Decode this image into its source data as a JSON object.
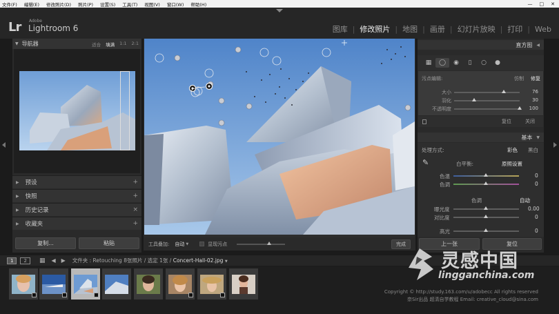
{
  "os_menu": [
    "文件(F)",
    "编辑(E)",
    "修改照片(D)",
    "照片(P)",
    "设置(S)",
    "工具(T)",
    "视图(V)",
    "窗口(W)",
    "帮助(H)"
  ],
  "window_controls": {
    "minimize": "—",
    "maximize": "□",
    "close": "✕"
  },
  "header": {
    "logo": "Lr",
    "adobe": "Adobe",
    "product": "Lightroom 6",
    "modules": [
      "图库",
      "修改照片",
      "地图",
      "画册",
      "幻灯片放映",
      "打印",
      "Web"
    ],
    "active_module": "修改照片"
  },
  "navigator": {
    "title": "导航器",
    "zoom_fit": "适合",
    "zoom_fill": "填满",
    "zoom_1": "1:1",
    "zoom_2": "2:1"
  },
  "left_sections": [
    {
      "label": "预设",
      "action": "+"
    },
    {
      "label": "快照",
      "action": "+"
    },
    {
      "label": "历史记录",
      "action": "×"
    },
    {
      "label": "收藏夹",
      "action": "+"
    }
  ],
  "left_buttons": {
    "copy": "复制...",
    "paste": "粘贴"
  },
  "toolbar": {
    "overlay_label": "工具叠加:",
    "overlay_value": "自动",
    "visualize_label": "显现污点",
    "done": "完成"
  },
  "right": {
    "histogram": "直方图",
    "spot": {
      "label": "污点编辑:",
      "mode_clone": "仿制",
      "mode_heal": "修复",
      "size_label": "大小",
      "size_value": 76,
      "feather_label": "羽化",
      "feather_value": 30,
      "opacity_label": "不透明度",
      "opacity_value": 100,
      "reset": "复位",
      "close": "关闭"
    },
    "basic": {
      "title": "基本",
      "treatment_label": "处理方式:",
      "color": "彩色",
      "bw": "黑白",
      "wb_label": "白平衡:",
      "wb_value": "原照设置",
      "temp_label": "色温",
      "temp_value": 0,
      "tint_label": "色调",
      "tint_value": 0,
      "tone_label": "色调",
      "tone_auto": "自动",
      "exposure_label": "曝光度",
      "exposure_value": "0.00",
      "contrast_label": "对比度",
      "contrast_value": 0,
      "highlights_label": "高光",
      "highlights_value": 0
    },
    "btn_prev": "上一张",
    "btn_reset": "复位"
  },
  "filmstrip": {
    "monitor_1": "1",
    "monitor_2": "2",
    "path_prefix": "文件夹 : Retouching  8张照片 / 选定 1张 /",
    "filename": "Concert-Hall-02.jpg"
  },
  "copyright_line1": "Copyright © http://study.163.com/u/adobecc All rights reserved",
  "copyright_line2": "奈Sir出品  超清自学教程 Email: creative_cloud@sina.com",
  "watermark_cn": "灵感中国",
  "watermark_en": "lingganchina.com",
  "colors": {
    "accent": "#efefef",
    "panel": "#2a2a2a",
    "sky": "#5d8fd0"
  }
}
